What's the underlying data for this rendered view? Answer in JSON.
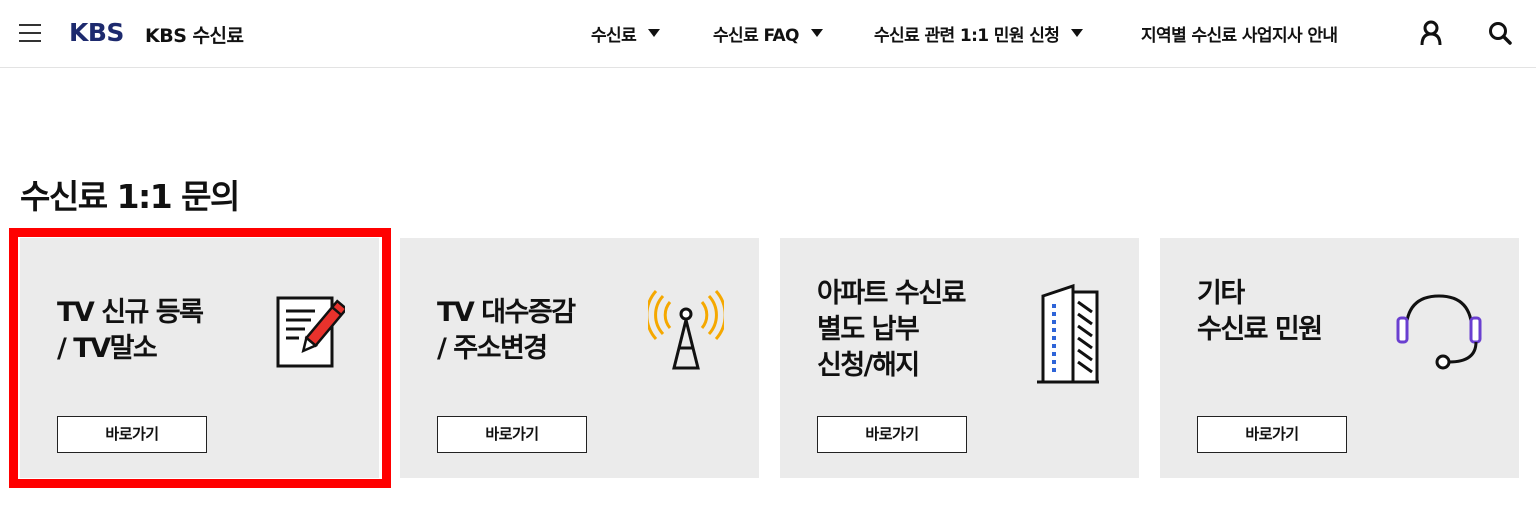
{
  "header": {
    "logo": "KBS",
    "site_title": "KBS 수신료",
    "nav": [
      {
        "label": "수신료",
        "has_caret": true
      },
      {
        "label": "수신료 FAQ",
        "has_caret": true
      },
      {
        "label": "수신료 관련 1:1 민원 신청",
        "has_caret": true
      },
      {
        "label": "지역별 수신료 사업지사 안내",
        "has_caret": false
      }
    ],
    "icons": [
      "menu-icon",
      "user-icon",
      "search-icon"
    ]
  },
  "main": {
    "title": "수신료 1:1 문의",
    "cards": [
      {
        "title": "TV 신규 등록\n/ TV말소",
        "button": "바로가기",
        "icon": "pencil-document-icon",
        "selected": true
      },
      {
        "title": "TV 대수증감\n/ 주소변경",
        "button": "바로가기",
        "icon": "antenna-tower-icon"
      },
      {
        "title": "아파트 수신료\n별도 납부\n신청/해지",
        "button": "바로가기",
        "icon": "apartment-building-icon"
      },
      {
        "title": "기타\n수신료 민원",
        "button": "바로가기",
        "icon": "headset-icon"
      }
    ]
  },
  "colors": {
    "brand": "#1d2a6e",
    "card_bg": "#ebebeb",
    "highlight": "#ff0000",
    "antenna_waves": "#f5a800",
    "headset_ear": "#6a3fd0",
    "building_windows": "#2e64d8"
  }
}
